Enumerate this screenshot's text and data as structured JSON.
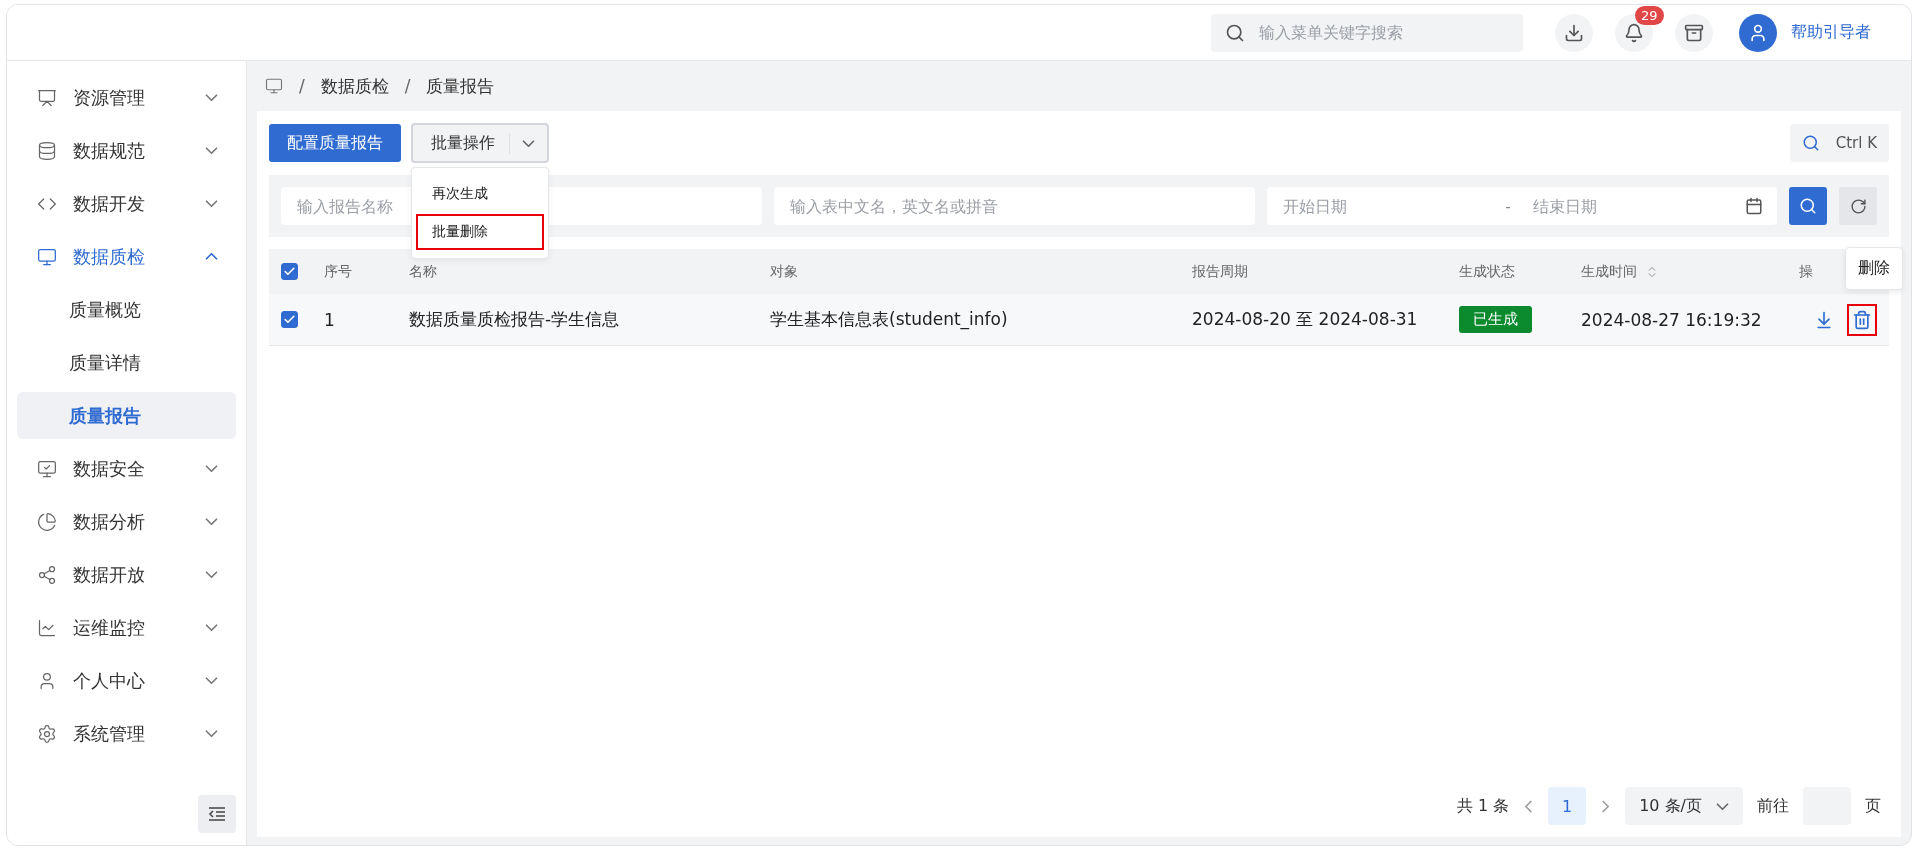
{
  "topbar": {
    "search": {
      "placeholder": "输入菜单关键字搜索"
    },
    "notification_count": "29",
    "user": "帮助引导者"
  },
  "sidebar": {
    "items": [
      {
        "label": "资源管理",
        "expanded": false,
        "selected": false
      },
      {
        "label": "数据规范",
        "expanded": false,
        "selected": false
      },
      {
        "label": "数据开发",
        "expanded": false,
        "selected": false
      },
      {
        "label": "数据质检",
        "expanded": true,
        "selected": true,
        "children": [
          {
            "label": "质量概览",
            "selected": false
          },
          {
            "label": "质量详情",
            "selected": false
          },
          {
            "label": "质量报告",
            "selected": true
          }
        ]
      },
      {
        "label": "数据安全",
        "expanded": false,
        "selected": false
      },
      {
        "label": "数据分析",
        "expanded": false,
        "selected": false
      },
      {
        "label": "数据开放",
        "expanded": false,
        "selected": false
      },
      {
        "label": "运维监控",
        "expanded": false,
        "selected": false
      },
      {
        "label": "个人中心",
        "expanded": false,
        "selected": false
      },
      {
        "label": "系统管理",
        "expanded": false,
        "selected": false
      }
    ]
  },
  "breadcrumb": {
    "separator": "/",
    "items": [
      "数据质检",
      "质量报告"
    ]
  },
  "toolbar": {
    "primary_button": "配置质量报告",
    "batch_button": "批量操作",
    "menu": [
      {
        "label": "再次生成",
        "highlighted": false
      },
      {
        "label": "批量删除",
        "highlighted": true
      }
    ],
    "shortcut": "Ctrl K"
  },
  "filters": {
    "name": {
      "placeholder": "输入报告名称"
    },
    "table": {
      "placeholder": "输入表中文名，英文名或拼音"
    },
    "date_range": {
      "start_placeholder": "开始日期",
      "separator": "-",
      "end_placeholder": "结束日期"
    }
  },
  "table": {
    "all_checked": true,
    "columns": [
      {
        "label": "序号",
        "sortable": false
      },
      {
        "label": "名称",
        "sortable": false
      },
      {
        "label": "对象",
        "sortable": false
      },
      {
        "label": "报告周期",
        "sortable": false
      },
      {
        "label": "生成状态",
        "sortable": false
      },
      {
        "label": "生成时间",
        "sortable": true
      },
      {
        "label": "操",
        "sortable": false
      }
    ],
    "rows": [
      {
        "checked": true,
        "index": "1",
        "name": "数据质量质检报告-学生信息",
        "object": "学生基本信息表(student_info)",
        "period": "2024-08-20 至 2024-08-31",
        "status": "已生成",
        "time": "2024-08-27 16:19:32",
        "delete_highlighted": true
      }
    ]
  },
  "tooltip": "删除",
  "pagination": {
    "total": "共 1 条",
    "pages": [
      {
        "label": "1",
        "selected": true
      }
    ],
    "page_size": "10 条/页",
    "goto_label": "前往",
    "page_suffix": "页"
  }
}
